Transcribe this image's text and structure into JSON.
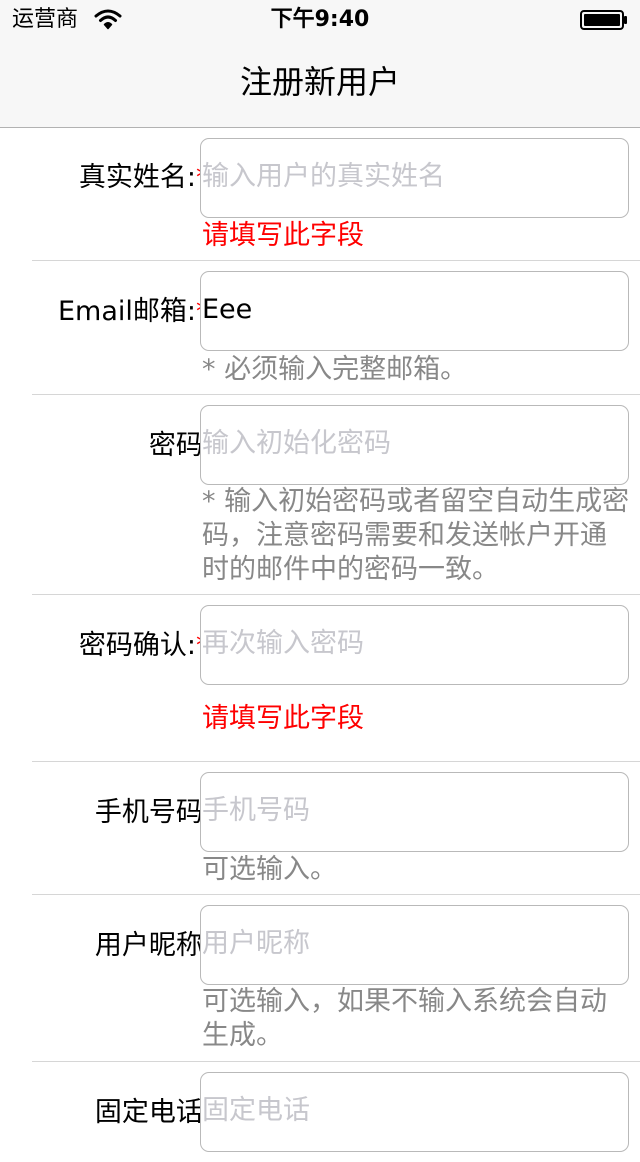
{
  "status_bar": {
    "carrier": "运营商",
    "time": "下午9:40",
    "wifi_icon": "wifi-icon",
    "battery_icon": "battery-icon"
  },
  "nav": {
    "title": "注册新用户"
  },
  "colors": {
    "required_mark": "#ff0000",
    "error_text": "#ff0000",
    "hint_text": "#888888",
    "placeholder": "#c7c7cd",
    "border": "#b9b9b9"
  },
  "form": {
    "real_name": {
      "label": "真实姓名:",
      "required_mark": "*",
      "placeholder": "输入用户的真实姓名",
      "value": "",
      "error": "请填写此字段"
    },
    "email": {
      "label": "Email邮箱:",
      "required_mark": "*",
      "placeholder": "",
      "value": "Eee",
      "hint": "* 必须输入完整邮箱。"
    },
    "password": {
      "label": "密码:",
      "placeholder": "输入初始化密码",
      "value": "",
      "hint": "* 输入初始密码或者留空自动生成密码，注意密码需要和发送帐户开通时的邮件中的密码一致。"
    },
    "password_confirm": {
      "label": "密码确认:",
      "required_mark": "*",
      "placeholder": "再次输入密码",
      "value": "",
      "error": "请填写此字段"
    },
    "mobile": {
      "label": "手机号码:",
      "placeholder": "手机号码",
      "value": "",
      "hint": "可选输入。"
    },
    "nickname": {
      "label": "用户昵称:",
      "placeholder": "用户昵称",
      "value": "",
      "hint": "可选输入，如果不输入系统会自动生成。"
    },
    "landline": {
      "label": "固定电话:",
      "placeholder": "固定电话",
      "value": ""
    }
  }
}
